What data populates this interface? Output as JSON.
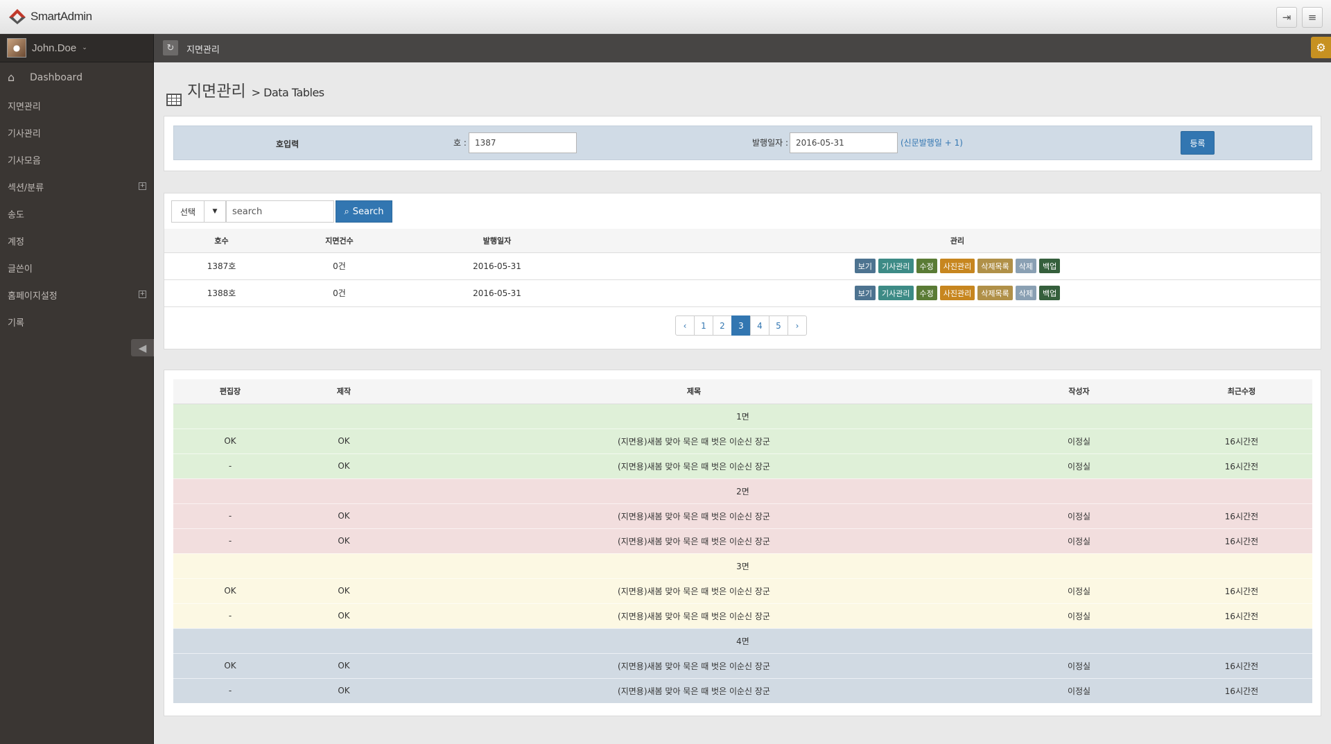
{
  "app": {
    "name": "SmartAdmin"
  },
  "header": {
    "logout_icon": "logout-icon",
    "menu_icon": "hamburger-icon"
  },
  "user": {
    "name": "John.Doe"
  },
  "sidebar": {
    "items": [
      {
        "label": "Dashboard",
        "icon": "home-icon"
      },
      {
        "label": "지면관리"
      },
      {
        "label": "기사관리"
      },
      {
        "label": "기사모음"
      },
      {
        "label": "섹션/분류",
        "expandable": true
      },
      {
        "label": "송도"
      },
      {
        "label": "계정"
      },
      {
        "label": "글쓴이"
      },
      {
        "label": "홈페이지설정",
        "expandable": true
      },
      {
        "label": "기록"
      }
    ]
  },
  "ribbon": {
    "breadcrumb": "지면관리"
  },
  "page": {
    "title": "지면관리",
    "subtitle": "> Data Tables"
  },
  "form": {
    "section_label": "호입력",
    "issue_label": "호 :",
    "issue_value": "1387",
    "date_label": "발행일자 :",
    "date_value": "2016-05-31",
    "date_note": "(신문발행일 + 1)",
    "submit_label": "등록"
  },
  "toolbar": {
    "select_label": "선택",
    "search_placeholder": "search",
    "search_button": "Search"
  },
  "issues_table": {
    "headers": [
      "호수",
      "지면건수",
      "발행일자",
      "관리"
    ],
    "actions": [
      "보기",
      "기사관리",
      "수정",
      "사진관리",
      "삭제목록",
      "삭제",
      "백업"
    ],
    "rows": [
      {
        "issue": "1387호",
        "count": "0건",
        "date": "2016-05-31"
      },
      {
        "issue": "1388호",
        "count": "0건",
        "date": "2016-05-31"
      }
    ]
  },
  "pagination": {
    "prev": "‹",
    "next": "›",
    "pages": [
      "1",
      "2",
      "3",
      "4",
      "5"
    ],
    "current": "3"
  },
  "pages_table": {
    "headers": [
      "편집장",
      "제작",
      "제목",
      "작성자",
      "최근수정"
    ],
    "groups": [
      {
        "label": "1면",
        "rows": [
          {
            "editor": "OK",
            "prod": "OK",
            "title": "(지면용)새봄 맞아 묵은 때 벗은 이순신 장군",
            "author": "이정실",
            "updated": "16시간전"
          },
          {
            "editor": "-",
            "prod": "OK",
            "title": "(지면용)새봄 맞아 묵은 때 벗은 이순신 장군",
            "author": "이정실",
            "updated": "16시간전"
          }
        ]
      },
      {
        "label": "2면",
        "rows": [
          {
            "editor": "-",
            "prod": "OK",
            "title": "(지면용)새봄 맞아 묵은 때 벗은 이순신 장군",
            "author": "이정실",
            "updated": "16시간전"
          },
          {
            "editor": "-",
            "prod": "OK",
            "title": "(지면용)새봄 맞아 묵은 때 벗은 이순신 장군",
            "author": "이정실",
            "updated": "16시간전"
          }
        ]
      },
      {
        "label": "3면",
        "rows": [
          {
            "editor": "OK",
            "prod": "OK",
            "title": "(지면용)새봄 맞아 묵은 때 벗은 이순신 장군",
            "author": "이정실",
            "updated": "16시간전"
          },
          {
            "editor": "-",
            "prod": "OK",
            "title": "(지면용)새봄 맞아 묵은 때 벗은 이순신 장군",
            "author": "이정실",
            "updated": "16시간전"
          }
        ]
      },
      {
        "label": "4면",
        "rows": [
          {
            "editor": "OK",
            "prod": "OK",
            "title": "(지면용)새봄 맞아 묵은 때 벗은 이순신 장군",
            "author": "이정실",
            "updated": "16시간전"
          },
          {
            "editor": "-",
            "prod": "OK",
            "title": "(지면용)새봄 맞아 묵은 때 벗은 이순신 장군",
            "author": "이정실",
            "updated": "16시간전"
          }
        ]
      }
    ]
  },
  "colors": {
    "primary": "#3276b1",
    "sidebar": "#3a3633",
    "ribbon": "#474544",
    "accent": "#c79121"
  }
}
